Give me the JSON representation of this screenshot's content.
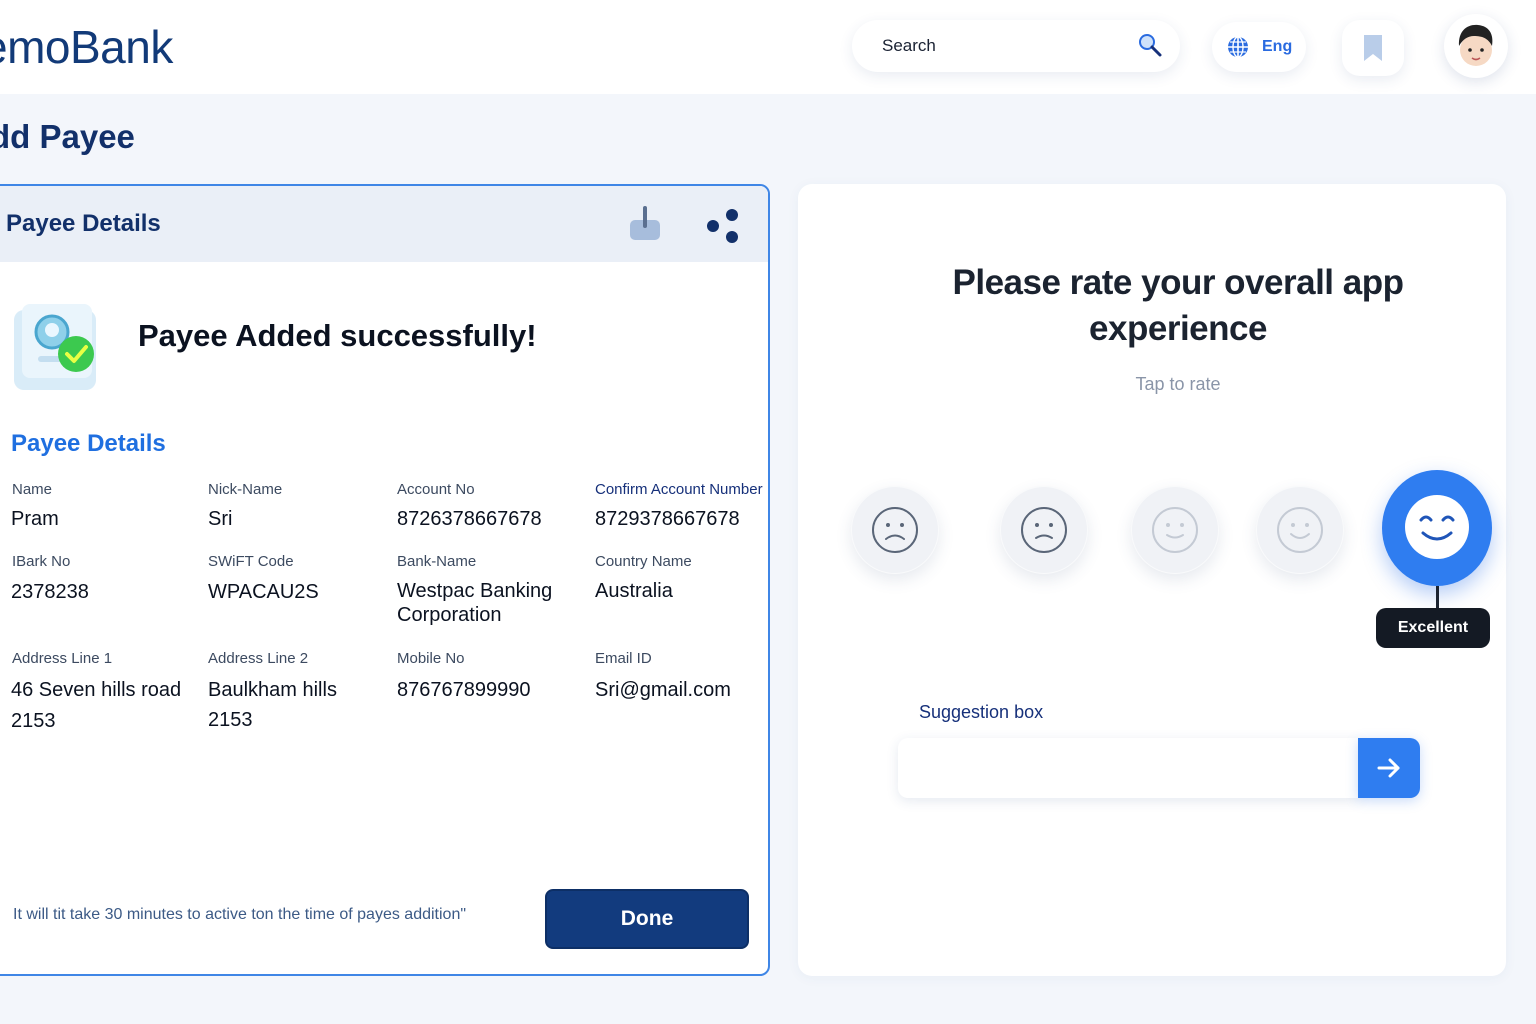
{
  "header": {
    "logo": "emoBank",
    "search_placeholder": "Search",
    "language": "Eng"
  },
  "page_title": "dd Payee",
  "payee_card": {
    "header_title": "Payee Details",
    "success_message": "Payee Added successfully!",
    "section_heading": "Payee Details",
    "fields": {
      "name": {
        "label": "Name",
        "value": "Pram"
      },
      "nickname": {
        "label": "Nick-Name",
        "value": "Sri"
      },
      "account_no": {
        "label": "Account No",
        "value": "8726378667678"
      },
      "confirm_account": {
        "label": "Confirm Account Number",
        "value": "8729378667678"
      },
      "ibark_no": {
        "label": "IBark No",
        "value": "2378238"
      },
      "swift_code": {
        "label": "SWiFT Code",
        "value": "WPACAU2S"
      },
      "bank_name": {
        "label": "Bank-Name",
        "value_line1": "Westpac Banking",
        "value_line2": "Corporation"
      },
      "country_name": {
        "label": "Country Name",
        "value": "Australia"
      },
      "address_line1": {
        "label": "Address Line 1",
        "value_line1": "46 Seven hills road",
        "value_line2": "2153"
      },
      "address_line2": {
        "label": "Address Line 2",
        "value_line1": "Baulkham hills",
        "value_line2": "2153"
      },
      "mobile_no": {
        "label": "Mobile No",
        "value": "876767899990"
      },
      "email_id": {
        "label": "Email ID",
        "value": "Sri@gmail.com"
      }
    },
    "footnote": "It will tit take 30 minutes to active ton the time of payes addition\"",
    "done_label": "Done"
  },
  "rating_card": {
    "question": "Please rate your overall app experience",
    "hint": "Tap to rate",
    "options": [
      "very-sad-face-icon",
      "sad-face-icon",
      "neutral-smile-face-icon",
      "smile-face-icon",
      "excellent-face-icon"
    ],
    "selected_label": "Excellent",
    "suggestion_label": "Suggestion box",
    "suggestion_placeholder": ""
  },
  "colors": {
    "primary_navy": "#123b7e",
    "accent_blue": "#2f7df0",
    "heading_blue": "#1f6fe0"
  }
}
